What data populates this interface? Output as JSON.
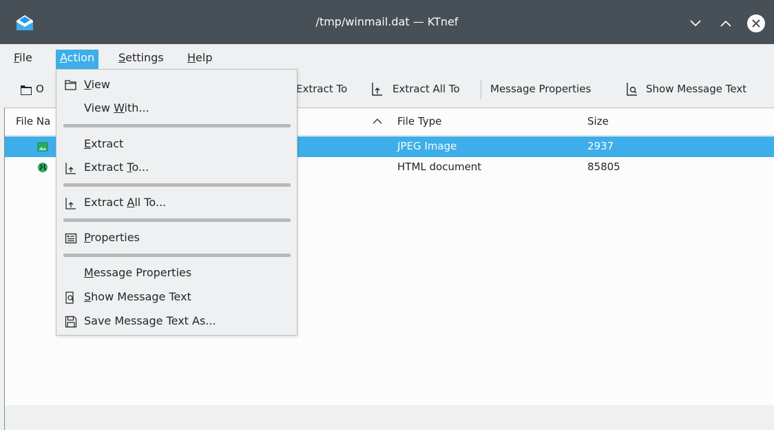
{
  "window": {
    "title": "/tmp/winmail.dat — KTnef",
    "icons": {
      "app": "envelope-icon",
      "minimize": "chevron-down-icon",
      "maximize": "chevron-up-icon",
      "close": "close-circle-icon"
    }
  },
  "menubar": {
    "file": {
      "u": "F",
      "rest": "ile"
    },
    "action": {
      "u": "A",
      "rest": "ction"
    },
    "settings": {
      "u": "S",
      "rest": "ettings"
    },
    "help": {
      "u": "H",
      "rest": "elp"
    }
  },
  "toolbar": {
    "open_label": "O",
    "extract_to": "Extract To",
    "extract_all_to": "Extract All To",
    "message_properties": "Message Properties",
    "show_message_text": "Show Message Text"
  },
  "filelist": {
    "columns": {
      "name": "File Na",
      "type": "File Type",
      "size": "Size"
    },
    "rows": [
      {
        "type": "JPEG Image",
        "size": "2937",
        "icon": "image-file-icon"
      },
      {
        "type": "HTML document",
        "size": "85805",
        "icon": "globe-icon"
      }
    ]
  },
  "action_menu": {
    "view": {
      "u": "V",
      "rest": "iew"
    },
    "view_with": {
      "pre": "View ",
      "u": "W",
      "rest": "ith..."
    },
    "extract": {
      "u": "E",
      "rest": "xtract"
    },
    "extract_to": {
      "pre": "Extract ",
      "u": "T",
      "rest": "o..."
    },
    "extract_all_to": {
      "pre": "Extract ",
      "u": "A",
      "rest": "ll To..."
    },
    "properties": {
      "u": "P",
      "rest": "roperties"
    },
    "message_properties": {
      "u": "M",
      "rest": "essage Properties"
    },
    "show_message_text": {
      "u": "S",
      "rest": "how Message Text"
    },
    "save_message_text_as": {
      "pre": "Save Messa",
      "u": "g",
      "rest": "e Text As..."
    }
  },
  "colors": {
    "accent": "#3daee9",
    "titlebar": "#475057",
    "window": "#eff0f1"
  }
}
